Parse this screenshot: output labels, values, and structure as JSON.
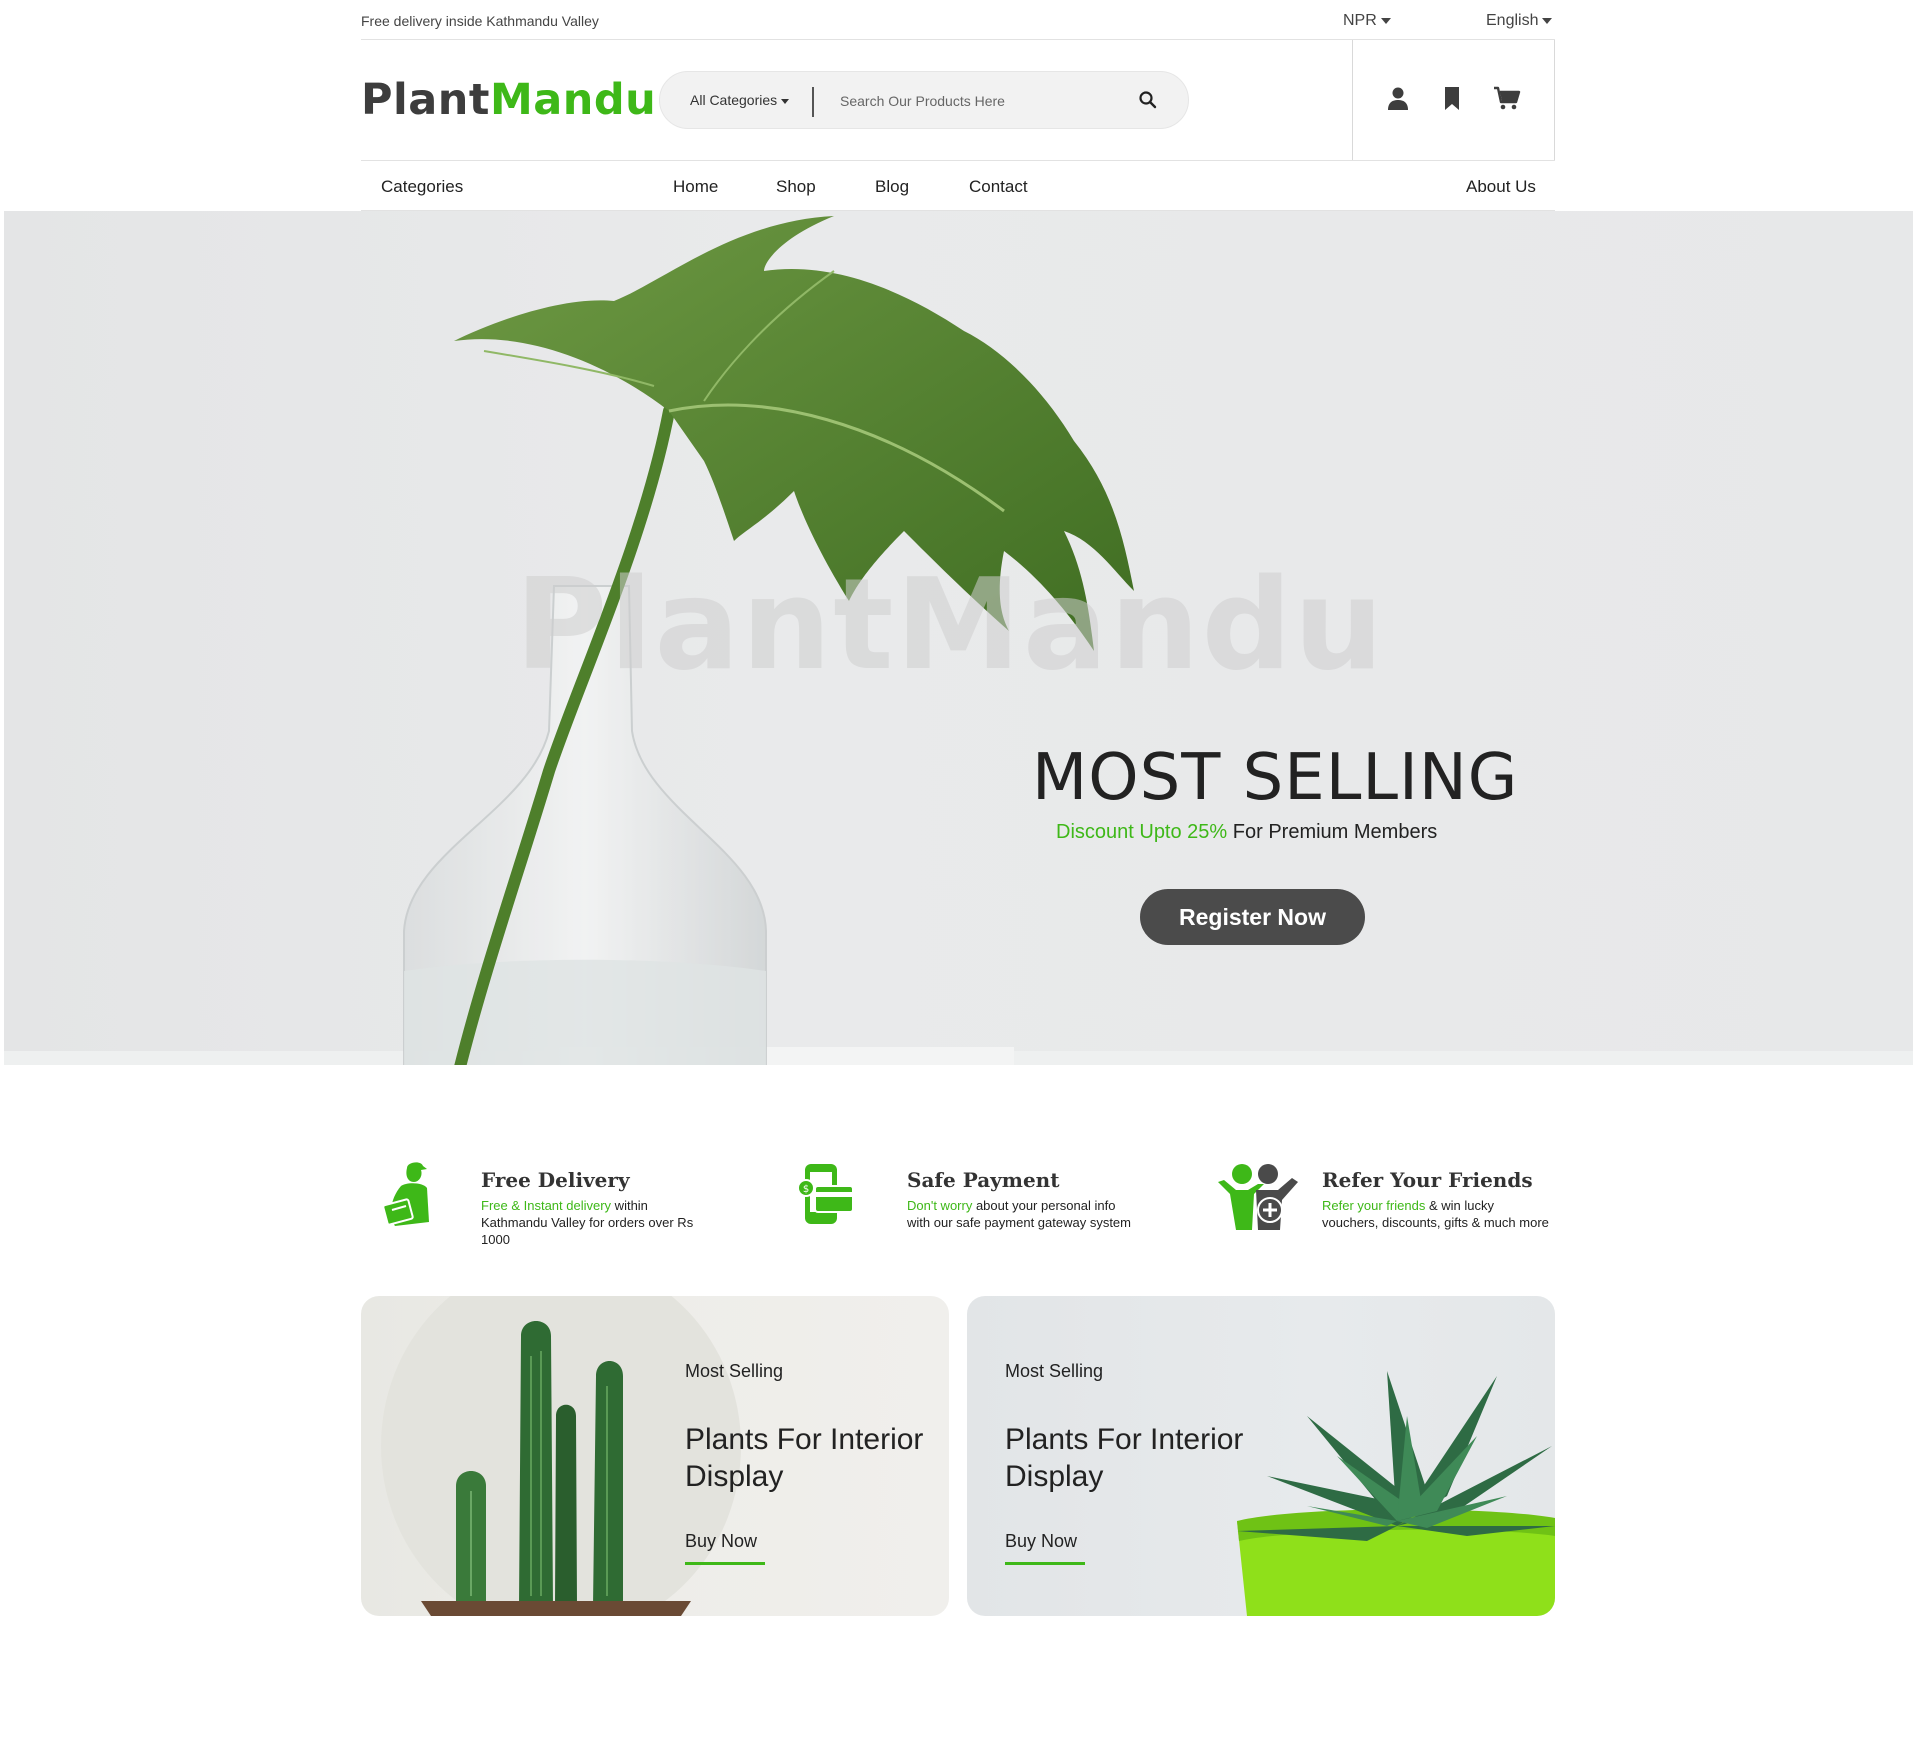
{
  "topbar": {
    "delivery_note": "Free delivery inside Kathmandu Valley",
    "currency": "NPR",
    "language": "English"
  },
  "header": {
    "logo_part1": "Plant",
    "logo_part2": "Mandu",
    "search": {
      "category": "All Categories",
      "placeholder": "Search Our Products Here"
    }
  },
  "nav": {
    "categories": "Categories",
    "items": [
      "Home",
      "Shop",
      "Blog",
      "Contact"
    ],
    "about": "About Us"
  },
  "hero": {
    "watermark": "PlantMandu",
    "title": "MOST SELLING",
    "subtitle_highlight": "Discount Upto 25%",
    "subtitle_rest": " For Premium Members",
    "cta": "Register Now"
  },
  "features": [
    {
      "title": "Free Delivery",
      "highlight": "Free & Instant delivery",
      "text": " within Kathmandu Valley for orders over Rs 1000",
      "icon": "delivery-person-icon"
    },
    {
      "title": "Safe Payment",
      "highlight": "Don't worry",
      "text": " about your personal info with our safe payment gateway system",
      "icon": "mobile-payment-icon"
    },
    {
      "title": "Refer Your Friends",
      "highlight": "Refer your friends",
      "text": " & win lucky vouchers, discounts, gifts & much more",
      "icon": "refer-friends-icon"
    }
  ],
  "promos": [
    {
      "label": "Most Selling",
      "title": "Plants For Interior Display",
      "cta": "Buy Now"
    },
    {
      "label": "Most Selling",
      "title": "Plants For Interior Display",
      "cta": "Buy Now"
    }
  ],
  "colors": {
    "accent": "#3eb818",
    "dark": "#3d3d3d",
    "button": "#4b4b4b"
  }
}
